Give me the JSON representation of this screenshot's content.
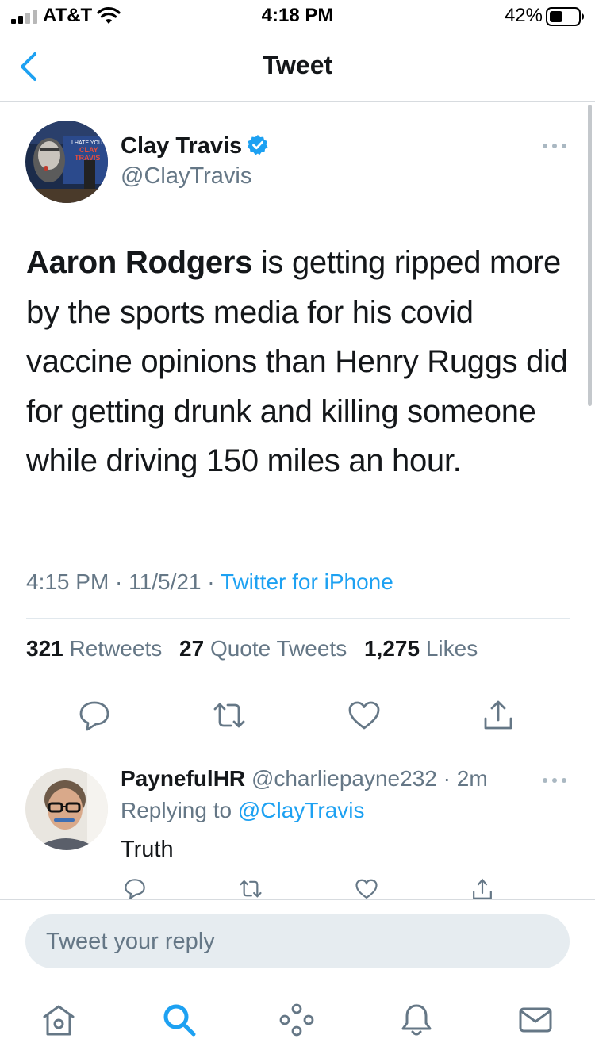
{
  "status_bar": {
    "carrier": "AT&T",
    "time": "4:18 PM",
    "battery": "42%"
  },
  "nav": {
    "title": "Tweet"
  },
  "tweet": {
    "author_name": "Clay Travis",
    "author_handle": "@ClayTravis",
    "text_bold": "Aaron Rodgers",
    "text_rest": " is getting ripped more by the sports media for his covid vaccine opinions than Henry Ruggs did for getting drunk and killing someone while driving 150 miles an hour.",
    "time": "4:15 PM",
    "date": "11/5/21",
    "source": "Twitter for iPhone",
    "separator": " · ",
    "avatar_text": [
      "I HATE YOU",
      "CLAY",
      "TRAVIS"
    ],
    "stats": {
      "retweets_count": "321",
      "retweets_label": "Retweets",
      "quotes_count": "27",
      "quotes_label": "Quote Tweets",
      "likes_count": "1,275",
      "likes_label": "Likes"
    }
  },
  "reply": {
    "name": "PaynefulHR",
    "handle": "@charliepayne232",
    "age": "2m",
    "replying_prefix": "Replying to",
    "replying_to": "@ClayTravis",
    "text": "Truth"
  },
  "compose": {
    "placeholder": "Tweet your reply"
  },
  "colors": {
    "accent": "#1da1f2",
    "secondary_text": "#657786",
    "primary_text": "#14171a",
    "divider": "#e1e8ed"
  },
  "icons": {
    "tab_bar": [
      "home-icon",
      "search-icon",
      "spaces-icon",
      "notifications-icon",
      "messages-icon"
    ],
    "tweet_actions": [
      "reply-icon",
      "retweet-icon",
      "like-icon",
      "share-icon"
    ]
  }
}
